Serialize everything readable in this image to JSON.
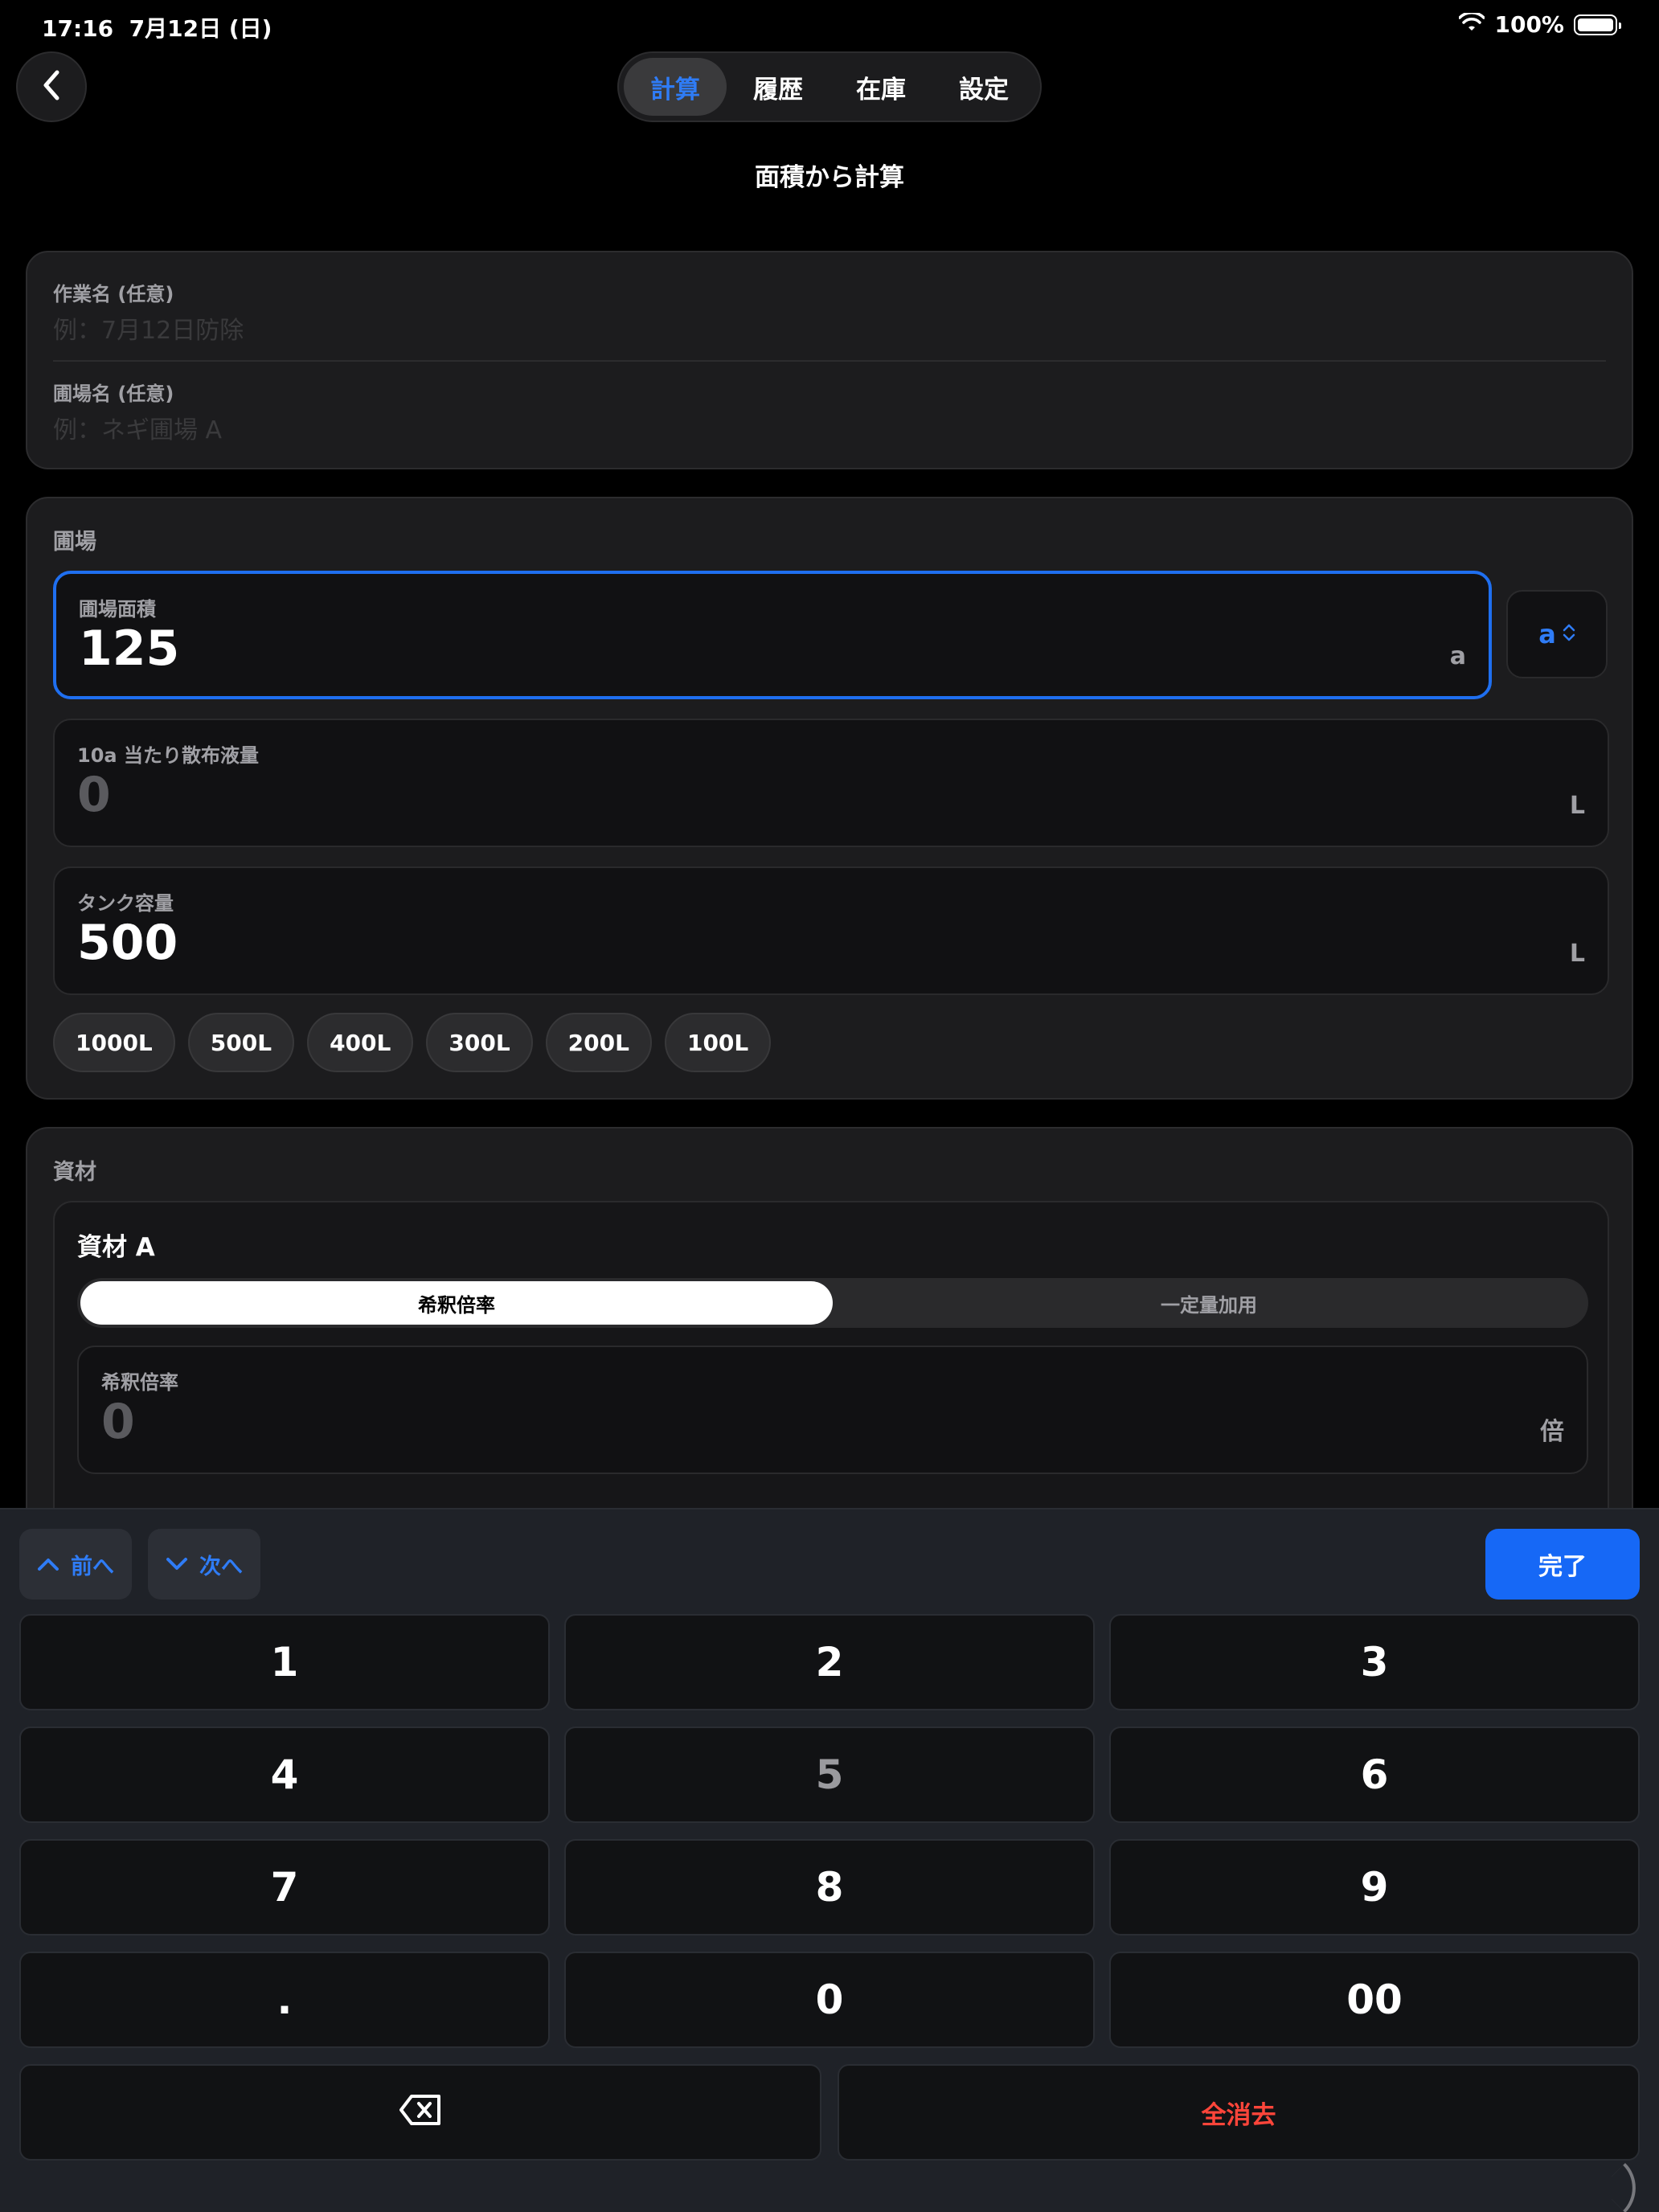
{
  "status_bar": {
    "time": "17:16",
    "date": "7月12日 (日)",
    "battery": "100%"
  },
  "tabs": [
    {
      "label": "計算",
      "active": true
    },
    {
      "label": "履歴",
      "active": false
    },
    {
      "label": "在庫",
      "active": false
    },
    {
      "label": "設定",
      "active": false
    }
  ],
  "page_title": "面積から計算",
  "optional": {
    "task_label": "作業名 (任意)",
    "task_placeholder": "例：7月12日防除",
    "field_label": "圃場名 (任意)",
    "field_placeholder": "例：ネギ圃場 A"
  },
  "field_section": {
    "title": "圃場",
    "area": {
      "label": "圃場面積",
      "value": "125",
      "unit": "a"
    },
    "unit_picker": "a",
    "spray": {
      "label": "10a 当たり散布液量",
      "value": "0",
      "unit": "L"
    },
    "tank": {
      "label": "タンク容量",
      "value": "500",
      "unit": "L"
    },
    "presets": [
      "1000L",
      "500L",
      "400L",
      "300L",
      "200L",
      "100L"
    ]
  },
  "materials": {
    "title": "資材",
    "item": {
      "name": "資材 A",
      "modes": [
        "希釈倍率",
        "一定量加用"
      ],
      "active_mode": "希釈倍率",
      "dilution": {
        "label": "希釈倍率",
        "value": "0",
        "unit": "倍"
      }
    }
  },
  "keyboard": {
    "prev": "前へ",
    "next": "次へ",
    "done": "完了",
    "keys": [
      "1",
      "2",
      "3",
      "4",
      "5",
      "6",
      "7",
      "8",
      "9",
      ".",
      "0",
      "00"
    ],
    "clear": "全消去"
  },
  "colors": {
    "accent": "#2f7cf6",
    "done": "#1668f6",
    "danger": "#ff453a",
    "background": "#000000"
  }
}
